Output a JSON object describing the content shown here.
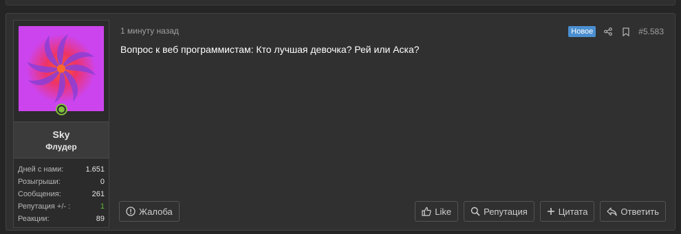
{
  "user": {
    "name": "Sky",
    "title": "Флудер",
    "stats": [
      {
        "label": "Дней с нами:",
        "value": "1.651",
        "color": ""
      },
      {
        "label": "Розыгрыши:",
        "value": "0",
        "color": ""
      },
      {
        "label": "Сообщения:",
        "value": "261",
        "color": ""
      },
      {
        "label": "Репутация +/- :",
        "value": "1",
        "color": "#5fbf3a"
      },
      {
        "label": "Реакции:",
        "value": "89",
        "color": ""
      }
    ]
  },
  "post": {
    "time": "1 минуту назад",
    "badge": "Новое",
    "number": "#5.583",
    "message": "Вопрос к веб программистам: Кто лучшая девочка? Рей или Аска?"
  },
  "actions": {
    "report": "Жалоба",
    "like": "Like",
    "reputation": "Репутация",
    "quote": "Цитата",
    "reply": "Ответить"
  },
  "colors": {
    "background": "#252525",
    "panel": "#303030",
    "badge": "#4a8fd0",
    "online": "#7fbf3a",
    "avatar_bg": "#cc44ee"
  }
}
